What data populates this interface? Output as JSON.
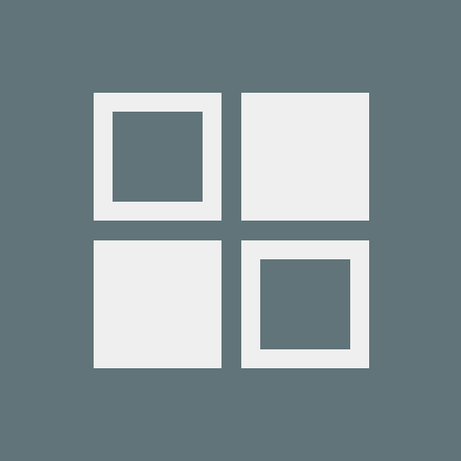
{
  "icon": {
    "name": "grid-view-icon",
    "background_color": "#607479",
    "foreground_color": "#efefef",
    "tiles": [
      {
        "name": "tile-top-left",
        "style": "outlined"
      },
      {
        "name": "tile-top-right",
        "style": "filled"
      },
      {
        "name": "tile-bottom-left",
        "style": "filled"
      },
      {
        "name": "tile-bottom-right",
        "style": "outlined"
      }
    ]
  }
}
